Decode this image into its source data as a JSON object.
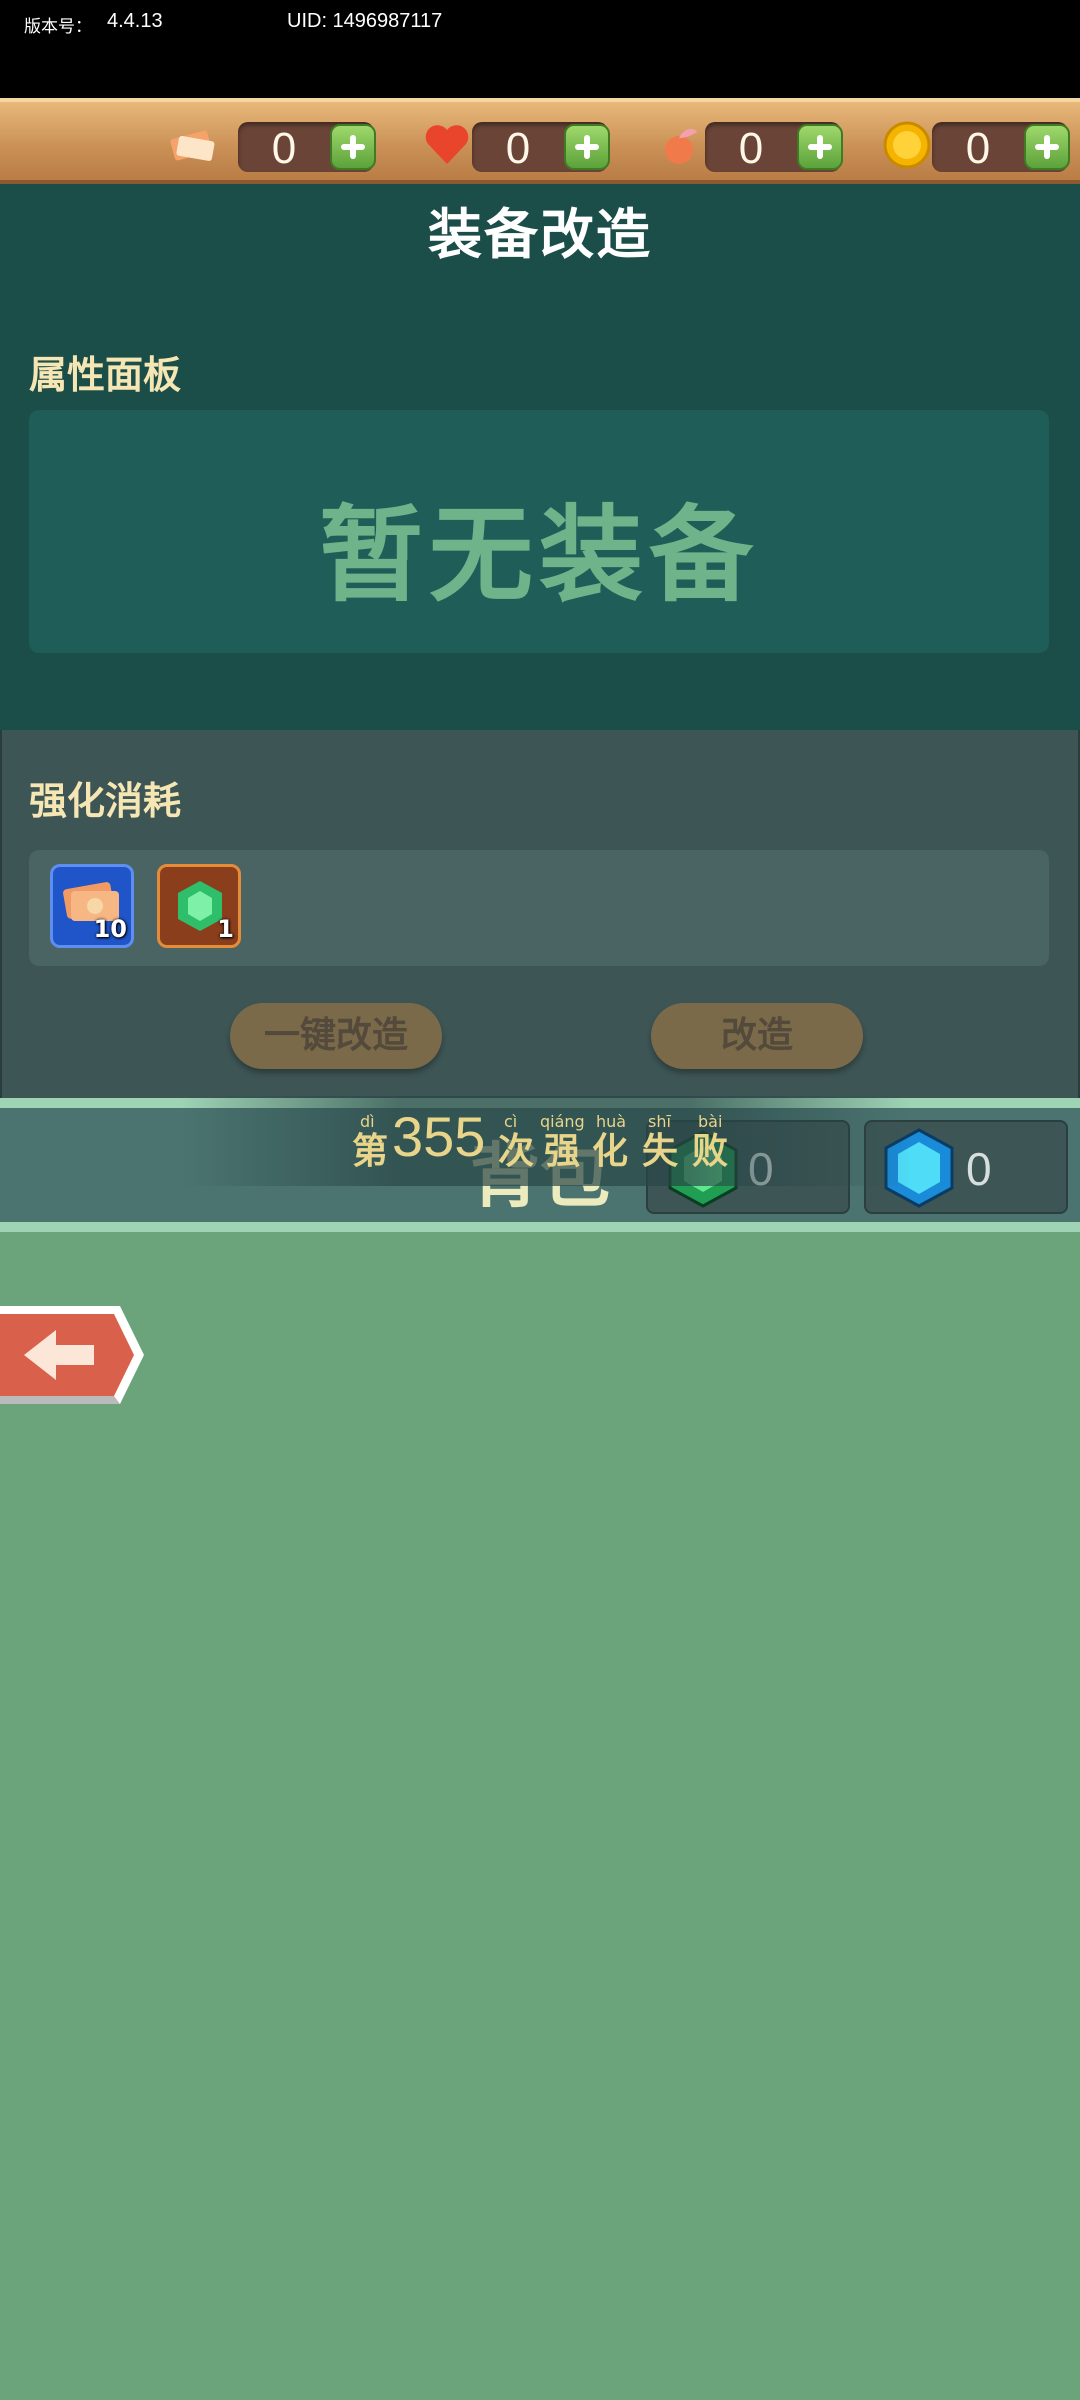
{
  "top_bar": {
    "version_label": "版本号：",
    "version_value": "4.4.13",
    "uid_label": "UID: 1496987117"
  },
  "currencies": [
    {
      "icon": "ticket-icon",
      "value": "0"
    },
    {
      "icon": "heart-icon",
      "value": "0"
    },
    {
      "icon": "peach-icon",
      "value": "0"
    },
    {
      "icon": "gold-coin-icon",
      "value": "0"
    }
  ],
  "page": {
    "title": "装备改造"
  },
  "attributes": {
    "title": "属性面板",
    "empty_text": "暂无装备"
  },
  "consume": {
    "title": "强化消耗",
    "items": [
      {
        "icon": "money-ticket-icon",
        "count": "10"
      },
      {
        "icon": "green-gem-icon",
        "count": "1"
      }
    ],
    "one_key_button": "一键改造",
    "modify_button": "改造"
  },
  "backpack": {
    "label": "背包",
    "gems": [
      {
        "icon": "green-gem-icon",
        "value": "0"
      },
      {
        "icon": "blue-gem-icon",
        "value": "0"
      }
    ]
  },
  "toast": {
    "prefix": "第",
    "number": "355",
    "chars": [
      "次",
      "强",
      "化",
      "失",
      "败"
    ],
    "pinyin": [
      "dì",
      "cì",
      "qiáng",
      "huà",
      "shī",
      "bài"
    ]
  },
  "colors": {
    "main_panel": "#1b4d49",
    "background": "#6ba47b",
    "accent_gold": "#f5e6b3"
  }
}
